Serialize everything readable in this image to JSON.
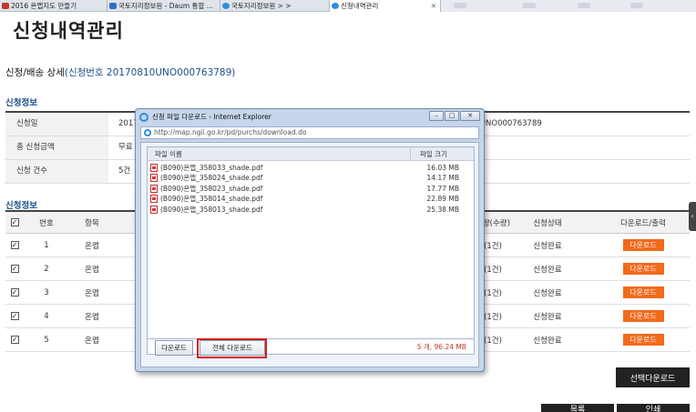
{
  "tabs": [
    {
      "label": "2016 온맵지도 만들기",
      "color": "#c0392b"
    },
    {
      "label": "국토지리정보원 - Daum 통합 ...",
      "color": "#2a6fc9"
    },
    {
      "label": "국토지리정보원 > >",
      "color": "#2f8ee0"
    },
    {
      "label": "신청내역관리",
      "color": "#2f8ee0"
    }
  ],
  "page": {
    "title": "신청내역관리",
    "subtitle": "신청/배송 상세",
    "order_no": "(신청번호 20170810UNO000763789)",
    "section1": "신청정보",
    "section2": "신청정보"
  },
  "info": [
    {
      "label": "신청일",
      "value": "2017",
      "value2": "10UNO000763789"
    },
    {
      "label": "총 신청금액",
      "value": "무료",
      "value2": ""
    },
    {
      "label": "신청 건수",
      "value": "5건",
      "value2": ""
    }
  ],
  "list": {
    "headers": {
      "check": "☑",
      "no": "번호",
      "item": "항목",
      "qty": "수량(수량)",
      "status": "신청상태",
      "dl": "다운로드/출력"
    },
    "rows": [
      {
        "no": "1",
        "item": "온맵",
        "qty": "(1건)",
        "status": "신청완료",
        "dl": "다운로드"
      },
      {
        "no": "2",
        "item": "온맵",
        "qty": "(1건)",
        "status": "신청완료",
        "dl": "다운로드"
      },
      {
        "no": "3",
        "item": "온맵",
        "qty": "(1건)",
        "status": "신청완료",
        "dl": "다운로드"
      },
      {
        "no": "4",
        "item": "온맵",
        "qty": "(1건)",
        "status": "신청완료",
        "dl": "다운로드"
      },
      {
        "no": "5",
        "item": "온맵",
        "qty": "(1건)",
        "status": "신청완료",
        "dl": "다운로드"
      }
    ]
  },
  "buttons": {
    "select_download": "선택다운로드",
    "bottom1": "목록",
    "bottom2": "인쇄"
  },
  "dialog": {
    "title": "신청 파일 다운로드 - Internet Explorer",
    "url": "http://map.ngii.go.kr/pd/purchs/download.do",
    "col_name": "파일 이름",
    "col_size": "파일 크기",
    "files": [
      {
        "name": "(B090)온맵_358033_shade.pdf",
        "size": "16.03 MB"
      },
      {
        "name": "(B090)온맵_358024_shade.pdf",
        "size": "14.17 MB"
      },
      {
        "name": "(B090)온맵_358023_shade.pdf",
        "size": "17.77 MB"
      },
      {
        "name": "(B090)온맵_358014_shade.pdf",
        "size": "22.89 MB"
      },
      {
        "name": "(B090)온맵_358013_shade.pdf",
        "size": "25.38 MB"
      }
    ],
    "total": "5 개, 96.24 MB",
    "btn_download": "다운로드",
    "btn_download_all": "전체 다운로드"
  },
  "colors": {
    "accent": "#f26a1b",
    "highlight": "#d42020",
    "link": "#1c4d8f"
  }
}
